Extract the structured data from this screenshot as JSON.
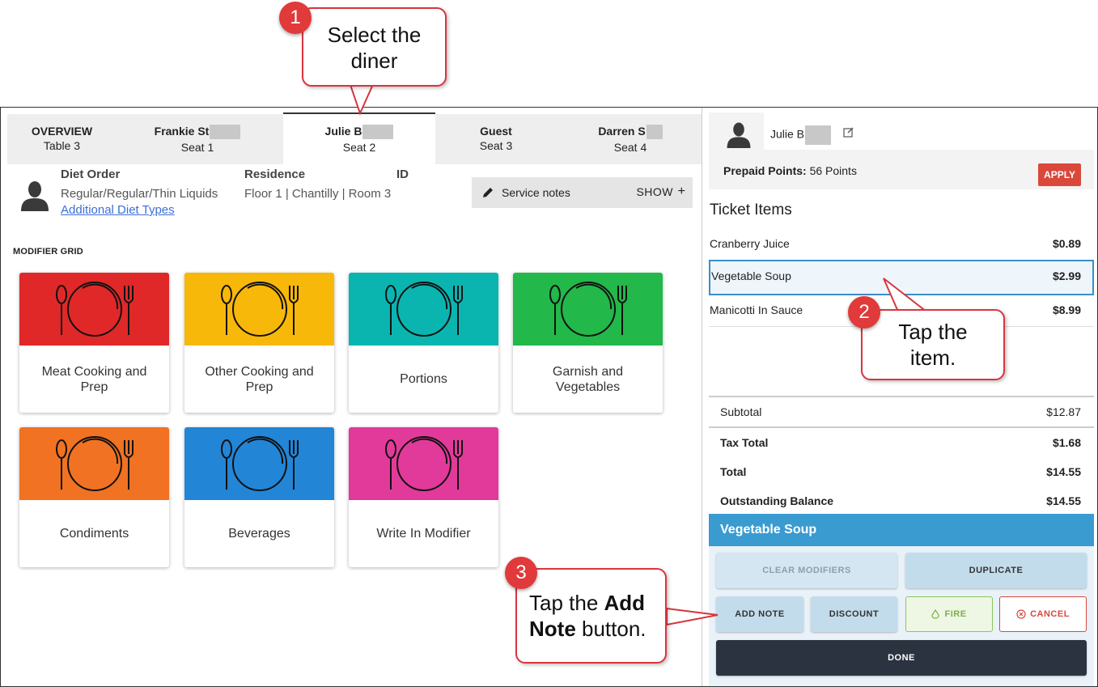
{
  "tabs": [
    {
      "name": "OVERVIEW",
      "sub": "Table 3"
    },
    {
      "name": "Frankie St",
      "sub": "Seat 1"
    },
    {
      "name": "Julie B",
      "sub": "Seat 2"
    },
    {
      "name": "Guest",
      "sub": "Seat 3"
    },
    {
      "name": "Darren S",
      "sub": "Seat 4"
    }
  ],
  "diner": {
    "diet_order_label": "Diet Order",
    "diet_order_value": "Regular/Regular/Thin Liquids",
    "diet_link": "Additional Diet Types",
    "residence_label": "Residence",
    "residence_value": "Floor 1 | Chantilly | Room 3",
    "id_label": "ID"
  },
  "service_notes": {
    "label": "Service notes",
    "action": "SHOW"
  },
  "modifier_grid": {
    "title": "MODIFIER GRID",
    "items": [
      {
        "label": "Meat Cooking and Prep",
        "color": "#e02828"
      },
      {
        "label": "Other Cooking and Prep",
        "color": "#f7b80a"
      },
      {
        "label": "Portions",
        "color": "#0ab5b0"
      },
      {
        "label": "Garnish and Vegetables",
        "color": "#22b84a"
      },
      {
        "label": "Condiments",
        "color": "#f07222"
      },
      {
        "label": "Beverages",
        "color": "#2385d6"
      },
      {
        "label": "Write In Modifier",
        "color": "#e23a9a"
      }
    ]
  },
  "right_panel": {
    "diner_name": "Julie B",
    "prepaid_label": "Prepaid Points:",
    "prepaid_value": "56 Points",
    "apply": "APPLY",
    "ticket_title": "Ticket Items",
    "items": [
      {
        "name": "Cranberry Juice",
        "price": "$0.89"
      },
      {
        "name": "Vegetable Soup",
        "price": "$2.99"
      },
      {
        "name": "Manicotti In Sauce",
        "price": "$8.99"
      }
    ],
    "subtotal_label": "Subtotal",
    "subtotal": "$12.87",
    "tax_label": "Tax Total",
    "tax": "$1.68",
    "total_label": "Total",
    "total": "$14.55",
    "balance_label": "Outstanding Balance",
    "balance": "$14.55",
    "selected_item": "Vegetable Soup",
    "buttons": {
      "clear": "CLEAR MODIFIERS",
      "duplicate": "DUPLICATE",
      "add_note": "ADD NOTE",
      "discount": "DISCOUNT",
      "fire": "FIRE",
      "cancel": "CANCEL",
      "done": "DONE"
    }
  },
  "callouts": {
    "c1_num": "1",
    "c1_text": "Select the diner",
    "c2_num": "2",
    "c2_text": "Tap the item.",
    "c3_num": "3",
    "c3_pre": "Tap the ",
    "c3_bold1": "Add",
    "c3_bold2": "Note",
    "c3_post": " button."
  }
}
